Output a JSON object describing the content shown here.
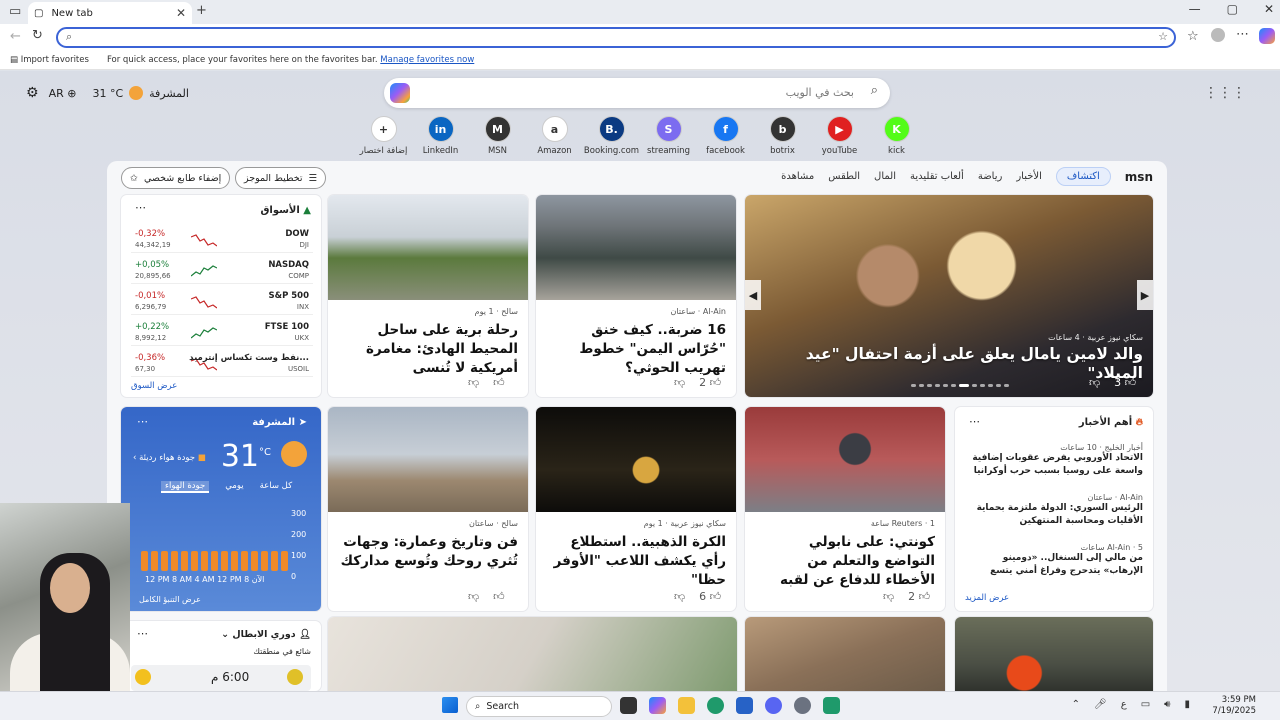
{
  "browser": {
    "tab_title": "New tab",
    "favbar_import": "Import favorites",
    "favbar_hint": "For quick access, place your favorites here on the favorites bar.",
    "favbar_manage": "Manage favorites now"
  },
  "ntp": {
    "location": "المشرفة",
    "temp": "31 °C",
    "lang": "AR",
    "search_placeholder": "بحث في الويب",
    "shortcuts": [
      {
        "label": "إضافة اختصار",
        "glyph": "+",
        "color": "#ffffff"
      },
      {
        "label": "LinkedIn",
        "glyph": "in",
        "color": "#0a66c2"
      },
      {
        "label": "MSN",
        "glyph": "M",
        "color": "#333333"
      },
      {
        "label": "Amazon",
        "glyph": "a",
        "color": "#ffffff"
      },
      {
        "label": "Booking.com",
        "glyph": "B.",
        "color": "#0b3a82"
      },
      {
        "label": "streaming",
        "glyph": "S",
        "color": "#7c6cf0"
      },
      {
        "label": "facebook",
        "glyph": "f",
        "color": "#1877f2"
      },
      {
        "label": "botrix",
        "glyph": "b",
        "color": "#333333"
      },
      {
        "label": "youTube",
        "glyph": "▶",
        "color": "#e02020"
      },
      {
        "label": "kick",
        "glyph": "K",
        "color": "#53fc18"
      }
    ]
  },
  "feed": {
    "brand": "msn",
    "nav": [
      "اكتشاف",
      "الأخبار",
      "رياضة",
      "ألعاب تقليدية",
      "المال",
      "الطقس",
      "مشاهدة"
    ],
    "personalize": "إضفاء طابع شخصي",
    "layout": "تخطيط الموجز",
    "hero": {
      "source": "سكاي نيوز عربية · 4 ساعات",
      "title": "والد لامين يامال يعلق على أزمة احتفال \"عيد الميلاد\"",
      "likes": "3"
    },
    "cards": [
      {
        "source": "Al-Ain · ساعتان",
        "title": "16 ضربة.. كيف خنق \"حُرّاس اليمن\" خطوط تهريب الحوثي؟",
        "likes": "2"
      },
      {
        "source": "سالح · 1 يوم",
        "title": "رحلة برية على ساحل المحيط الهادئ: مغامرة أمريكية لا تُنسى",
        "likes": ""
      },
      {
        "source": "Reuters · 1 ساعة",
        "title": "كونتي: على نابولي التواضع والتعلم من الأخطاء للدفاع عن لقبه",
        "likes": "2"
      },
      {
        "source": "سكاي نيوز عربية · 1 يوم",
        "title": "الكرة الذهبية.. استطلاع رأي يكشف اللاعب \"الأوفر حظا\"",
        "likes": "6"
      },
      {
        "source": "سالح · ساعتان",
        "title": "فن وتاريخ وعمارة: وجهات تُثري روحك وتُوسع مداركك",
        "likes": ""
      }
    ],
    "markets": {
      "title": "الأسواق",
      "footer": "عرض السوق",
      "rows": [
        {
          "name": "DOW",
          "sub": "DJI",
          "change": "-0,32%",
          "value": "44,342,19",
          "dir": "neg"
        },
        {
          "name": "NASDAQ",
          "sub": "COMP",
          "change": "+0,05%",
          "value": "20,895,66",
          "dir": "pos"
        },
        {
          "name": "S&P 500",
          "sub": "INX",
          "change": "-0,01%",
          "value": "6,296,79",
          "dir": "neg"
        },
        {
          "name": "FTSE 100",
          "sub": "UKX",
          "change": "+0,22%",
          "value": "8,992,12",
          "dir": "pos"
        },
        {
          "name": "نفط وست تكساس إنترميد...",
          "sub": "USOIL",
          "change": "-0,36%",
          "value": "67,30",
          "dir": "neg"
        }
      ]
    },
    "weather": {
      "location": "المشرفة",
      "temp": "31",
      "unit": "°C",
      "aq_label": "جودة هواء رديئة",
      "tabs": [
        "كل ساعة",
        "يومي",
        "جودة الهواء"
      ],
      "axis": [
        "300",
        "200",
        "100",
        "0"
      ],
      "times": "12 PM 8 AM 4 AM 12 PM 8 الآن",
      "footer": "عرض التنبؤ الكامل"
    },
    "top_news": {
      "title": "أهم الأخبار",
      "footer": "عرض المزيد",
      "items": [
        {
          "source": "أخبار الخليج · 10 ساعات",
          "title": "الاتحاد الأوروبي يفرض عقوبات إضافية واسعة على روسيا بسبب حرب أوكرانيا"
        },
        {
          "source": "Al-Ain · ساعتان",
          "title": "الرئيس السوري: الدولة ملتزمة بحماية الأقليات ومحاسبة المنتهكين"
        },
        {
          "source": "Al-Ain · 5 ساعات",
          "title": "من مالي إلى السنغال.. «دومينو الإرهاب» يتدحرج وفراغ أمني يتسع"
        }
      ]
    },
    "league": {
      "title": "دوري الابطال",
      "sub": "شائع في منطقتك",
      "time": "6:00 م"
    }
  },
  "taskbar": {
    "search": "Search",
    "time": "3:59 PM",
    "date": "7/19/2025",
    "lang": "ع"
  }
}
